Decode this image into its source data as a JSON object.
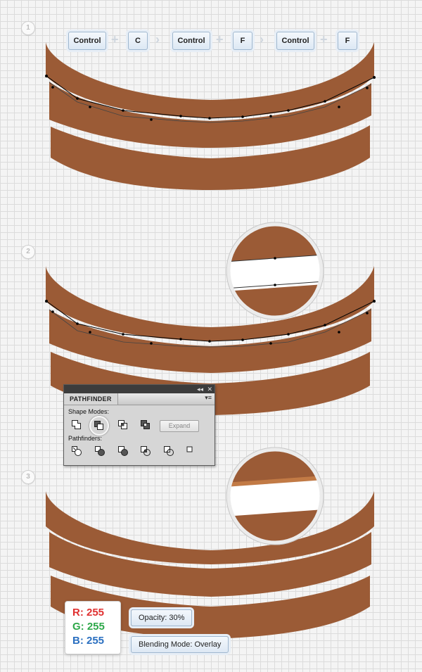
{
  "steps": [
    {
      "number": "1"
    },
    {
      "number": "2"
    },
    {
      "number": "3"
    }
  ],
  "shortcut": {
    "keys": [
      "Control",
      "C",
      "Control",
      "F",
      "Control",
      "F"
    ],
    "plus_glyph": "+",
    "arrow_glyph": "›"
  },
  "colors": {
    "band_brown": "#9b5b36",
    "edge_brown": "#c27a45",
    "red": "#e03030",
    "green": "#2ea84a",
    "blue": "#2a6fc0"
  },
  "pathfinder": {
    "title": "PATHFINDER",
    "collapse_glyph": "◂◂",
    "close_glyph": "✕",
    "menu_glyph": "▾≡",
    "shape_modes_label": "Shape Modes:",
    "pathfinders_label": "Pathfinders:",
    "expand_label": "Expand",
    "shape_mode_icons": [
      "unite-icon",
      "minus-front-icon",
      "intersect-icon",
      "exclude-icon"
    ],
    "pathfinder_icons": [
      "divide-icon",
      "trim-icon",
      "merge-icon",
      "crop-icon",
      "outline-icon",
      "minus-back-icon"
    ]
  },
  "color_values": {
    "r_label": "R: 255",
    "g_label": "G: 255",
    "b_label": "B: 255"
  },
  "settings": {
    "opacity_label": "Opacity: 30%",
    "blending_label": "Blending Mode: Overlay"
  }
}
